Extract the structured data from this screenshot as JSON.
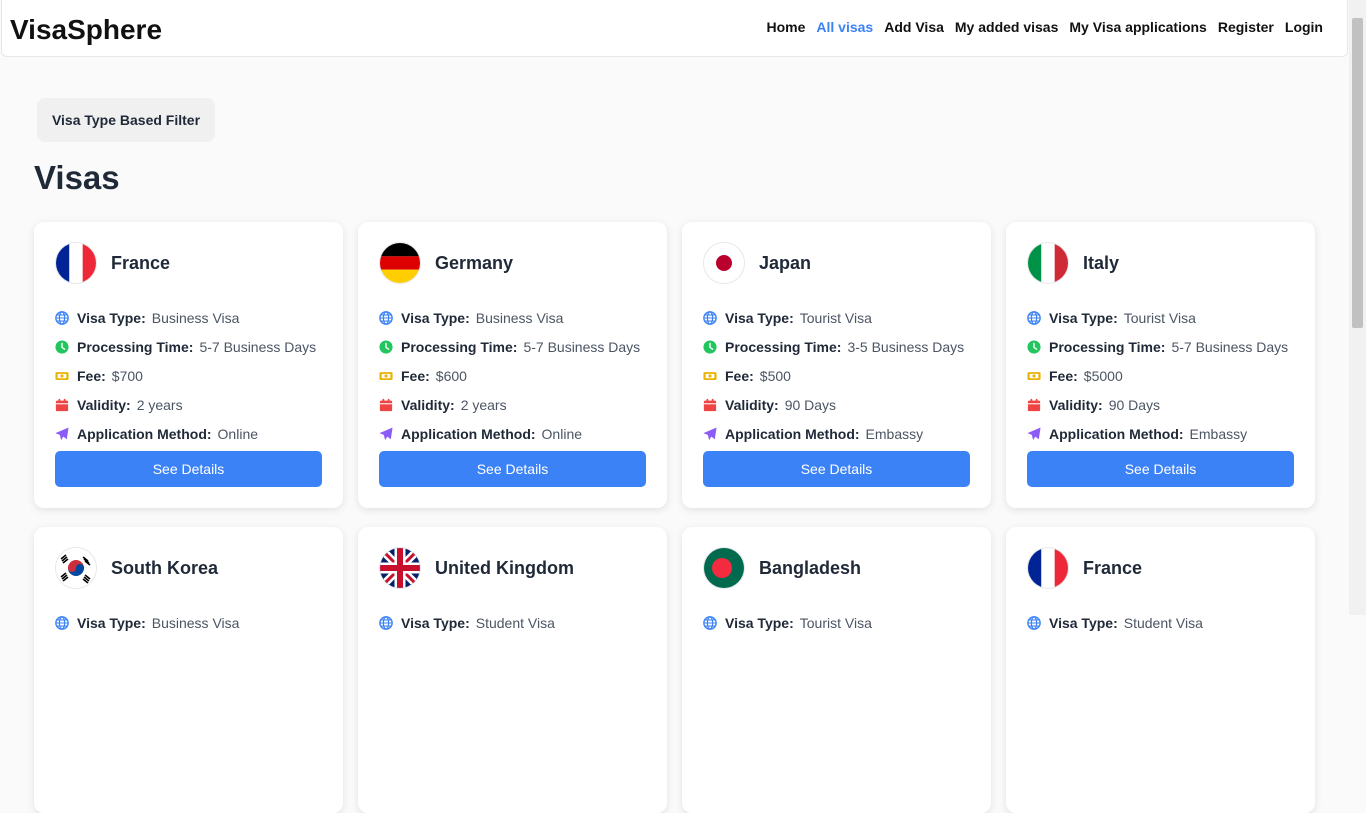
{
  "app": {
    "brand": "VisaSphere"
  },
  "nav": {
    "links": [
      {
        "label": "Home",
        "active": false
      },
      {
        "label": "All visas",
        "active": true
      },
      {
        "label": "Add Visa",
        "active": false
      },
      {
        "label": "My added visas",
        "active": false
      },
      {
        "label": "My Visa applications",
        "active": false
      },
      {
        "label": "Register",
        "active": false
      },
      {
        "label": "Login",
        "active": false
      }
    ]
  },
  "filter": {
    "label": "Visa Type Based Filter"
  },
  "page": {
    "title": "Visas"
  },
  "labels": {
    "visa_type": "Visa Type:",
    "processing_time": "Processing Time:",
    "fee": "Fee:",
    "validity": "Validity:",
    "application_method": "Application Method:",
    "details_button": "See Details"
  },
  "colors": {
    "accent": "#3b82f6",
    "globe": "#3b82f6",
    "clock": "#22c55e",
    "fee": "#eab308",
    "calendar": "#ef4444",
    "plane": "#8b5cf6"
  },
  "cards": [
    {
      "country": "France",
      "flag": "france-flag",
      "visa_type": "Business Visa",
      "processing_time": "5-7 Business Days",
      "fee": "$700",
      "validity": "2 years",
      "application_method": "Online"
    },
    {
      "country": "Germany",
      "flag": "germany-flag",
      "visa_type": "Business Visa",
      "processing_time": "5-7 Business Days",
      "fee": "$600",
      "validity": "2 years",
      "application_method": "Online"
    },
    {
      "country": "Japan",
      "flag": "japan-flag",
      "visa_type": "Tourist Visa",
      "processing_time": "3-5 Business Days",
      "fee": "$500",
      "validity": "90 Days",
      "application_method": "Embassy"
    },
    {
      "country": "Italy",
      "flag": "italy-flag",
      "visa_type": "Tourist Visa",
      "processing_time": "5-7 Business Days",
      "fee": "$5000",
      "validity": "90 Days",
      "application_method": "Embassy"
    },
    {
      "country": "South Korea",
      "flag": "south-korea-flag",
      "visa_type": "Business Visa"
    },
    {
      "country": "United Kingdom",
      "flag": "uk-flag",
      "visa_type": "Student Visa"
    },
    {
      "country": "Bangladesh",
      "flag": "bangladesh-flag",
      "visa_type": "Tourist Visa"
    },
    {
      "country": "France",
      "flag": "france-flag",
      "visa_type": "Student Visa"
    }
  ]
}
